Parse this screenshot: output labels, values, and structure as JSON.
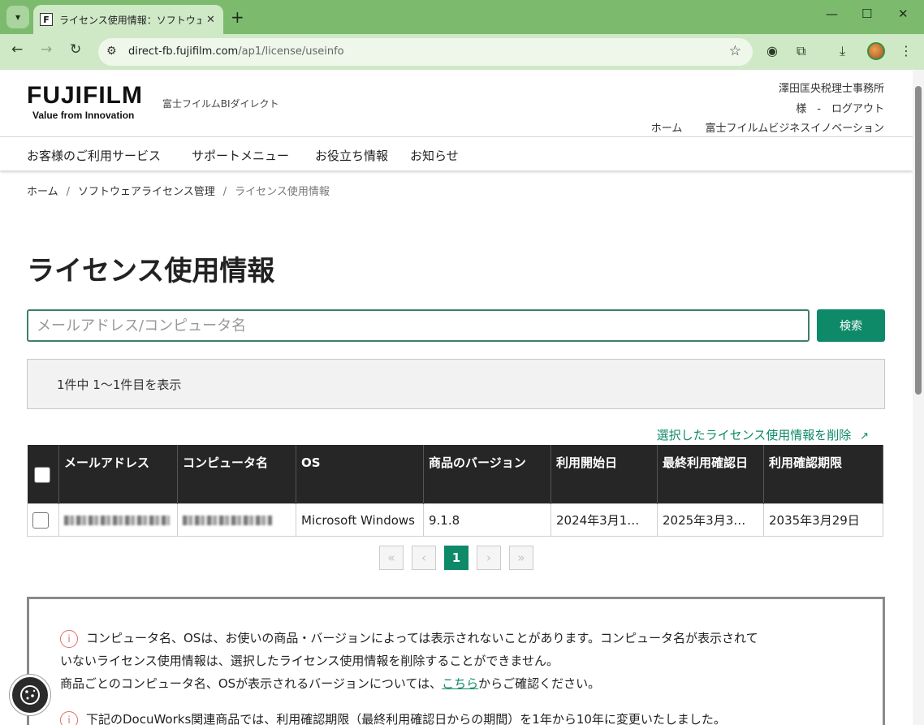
{
  "browser": {
    "tab_title": "ライセンス使用情報：ソフトウェアライセ",
    "favicon_letter": "F",
    "url_host": "direct-fb.fujifilm.com",
    "url_path": "/ap1/license/useinfo"
  },
  "header": {
    "logo_main": "FUJIFILM",
    "logo_sub": "Value from Innovation",
    "brand_sub": "富士フイルムBIダイレクト",
    "company": "澤田匡央税理士事務所",
    "user_line": "様　-　ログアウト",
    "links": [
      "ホーム",
      "富士フイルムビジネスイノベーション"
    ]
  },
  "nav": {
    "items": [
      "お客様のご利用サービス",
      "サポートメニュー",
      "お役立ち情報",
      "お知らせ"
    ]
  },
  "breadcrumb": {
    "home": "ホーム",
    "parent": "ソフトウェアライセンス管理",
    "current": "ライセンス使用情報",
    "separator": "/"
  },
  "page": {
    "title": "ライセンス使用情報"
  },
  "search": {
    "placeholder": "メールアドレス/コンピュータ名",
    "button_label": "検索"
  },
  "results": {
    "count_text": "1件中 1〜1件目を表示",
    "delete_link": "選択したライセンス使用情報を削除"
  },
  "table": {
    "headers": {
      "email": "メールアドレス",
      "computer": "コンピュータ名",
      "os": "OS",
      "version": "商品のバージョン",
      "start": "利用開始日",
      "last_confirm": "最終利用確認日",
      "deadline": "利用確認期限"
    },
    "rows": [
      {
        "os": "Microsoft Windows",
        "version": "9.1.8",
        "start": "2024年3月1…",
        "last_confirm": "2025年3月3…",
        "deadline": "2035年3月29日"
      }
    ]
  },
  "pagination": {
    "first": "«",
    "prev": "‹",
    "current": "1",
    "next": "›",
    "last": "»"
  },
  "notice": {
    "line1": "コンピュータ名、OSは、お使いの商品・バージョンによっては表示されないことがあります。コンピュータ名が表示されて",
    "line2": "いないライセンス使用情報は、選択したライセンス使用情報を削除することができません。",
    "line3_before": "商品ごとのコンピュータ名、OSが表示されるバージョンについては、",
    "line3_link": "こちら",
    "line3_after": "からご確認ください。",
    "line4": "下記のDocuWorks関連商品では、利用確認期限（最終利用確認日からの期間）を1年から10年に変更いたしました。"
  },
  "colors": {
    "accent": "#0e8a68",
    "table_header": "#262626",
    "browser_frame": "#7cbb6e"
  }
}
